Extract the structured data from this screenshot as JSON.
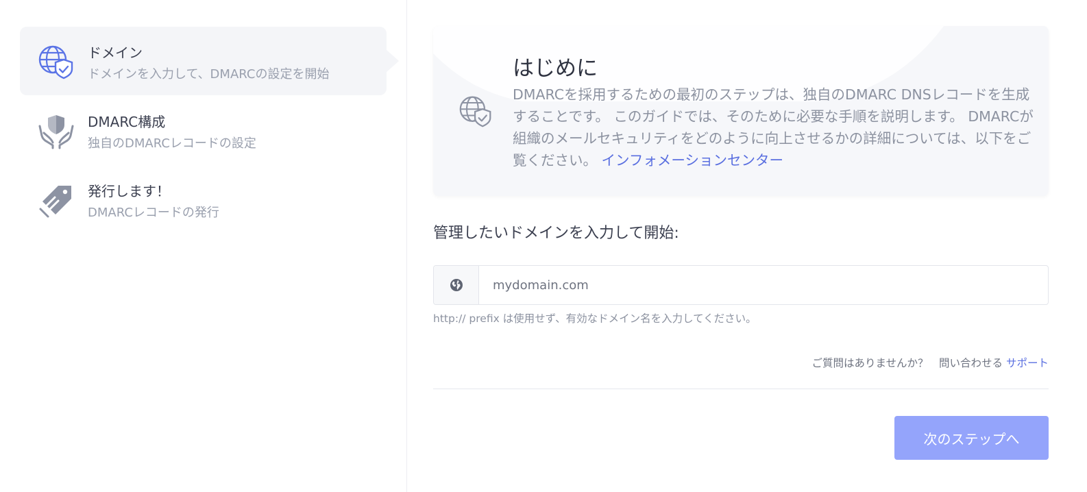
{
  "colors": {
    "accent": "#94a4fb",
    "link": "#5a6fe0",
    "icon_blue": "#5b74e6",
    "icon_gray": "#8d93a3",
    "active_step_bg": "#f4f5f8"
  },
  "sidebar": {
    "steps": [
      {
        "title": "ドメイン",
        "subtitle": "ドメインを入力して、DMARCの設定を開始",
        "icon": "globe-shield-icon",
        "active": true
      },
      {
        "title": "DMARC構成",
        "subtitle": "独自のDMARCレコードの設定",
        "icon": "hands-shield-icon",
        "active": false
      },
      {
        "title": "発行します！",
        "subtitle": "DMARCレコードの発行",
        "icon": "tag-icon",
        "active": false
      }
    ]
  },
  "intro": {
    "icon": "globe-shield-icon",
    "title": "はじめに",
    "text": "DMARCを採用するための最初のステップは、独自のDMARC DNSレコードを生成することです。 このガイドでは、そのために必要な手順を説明します。 DMARCが組織のメールセキュリティをどのように向上させるかの詳細については、以下をご覧ください。",
    "link_label": "インフォメーションセンター"
  },
  "form": {
    "prompt": "管理したいドメインを入力して開始:",
    "input_icon": "globe-icon",
    "input_value": "",
    "input_placeholder": "mydomain.com",
    "help_text": "http:// prefix は使用せず、有効なドメイン名を入力してください。",
    "question_text": "ご質問はありませんか？　問い合わせる ",
    "support_link": "サポート",
    "next_button": "次のステップへ"
  }
}
